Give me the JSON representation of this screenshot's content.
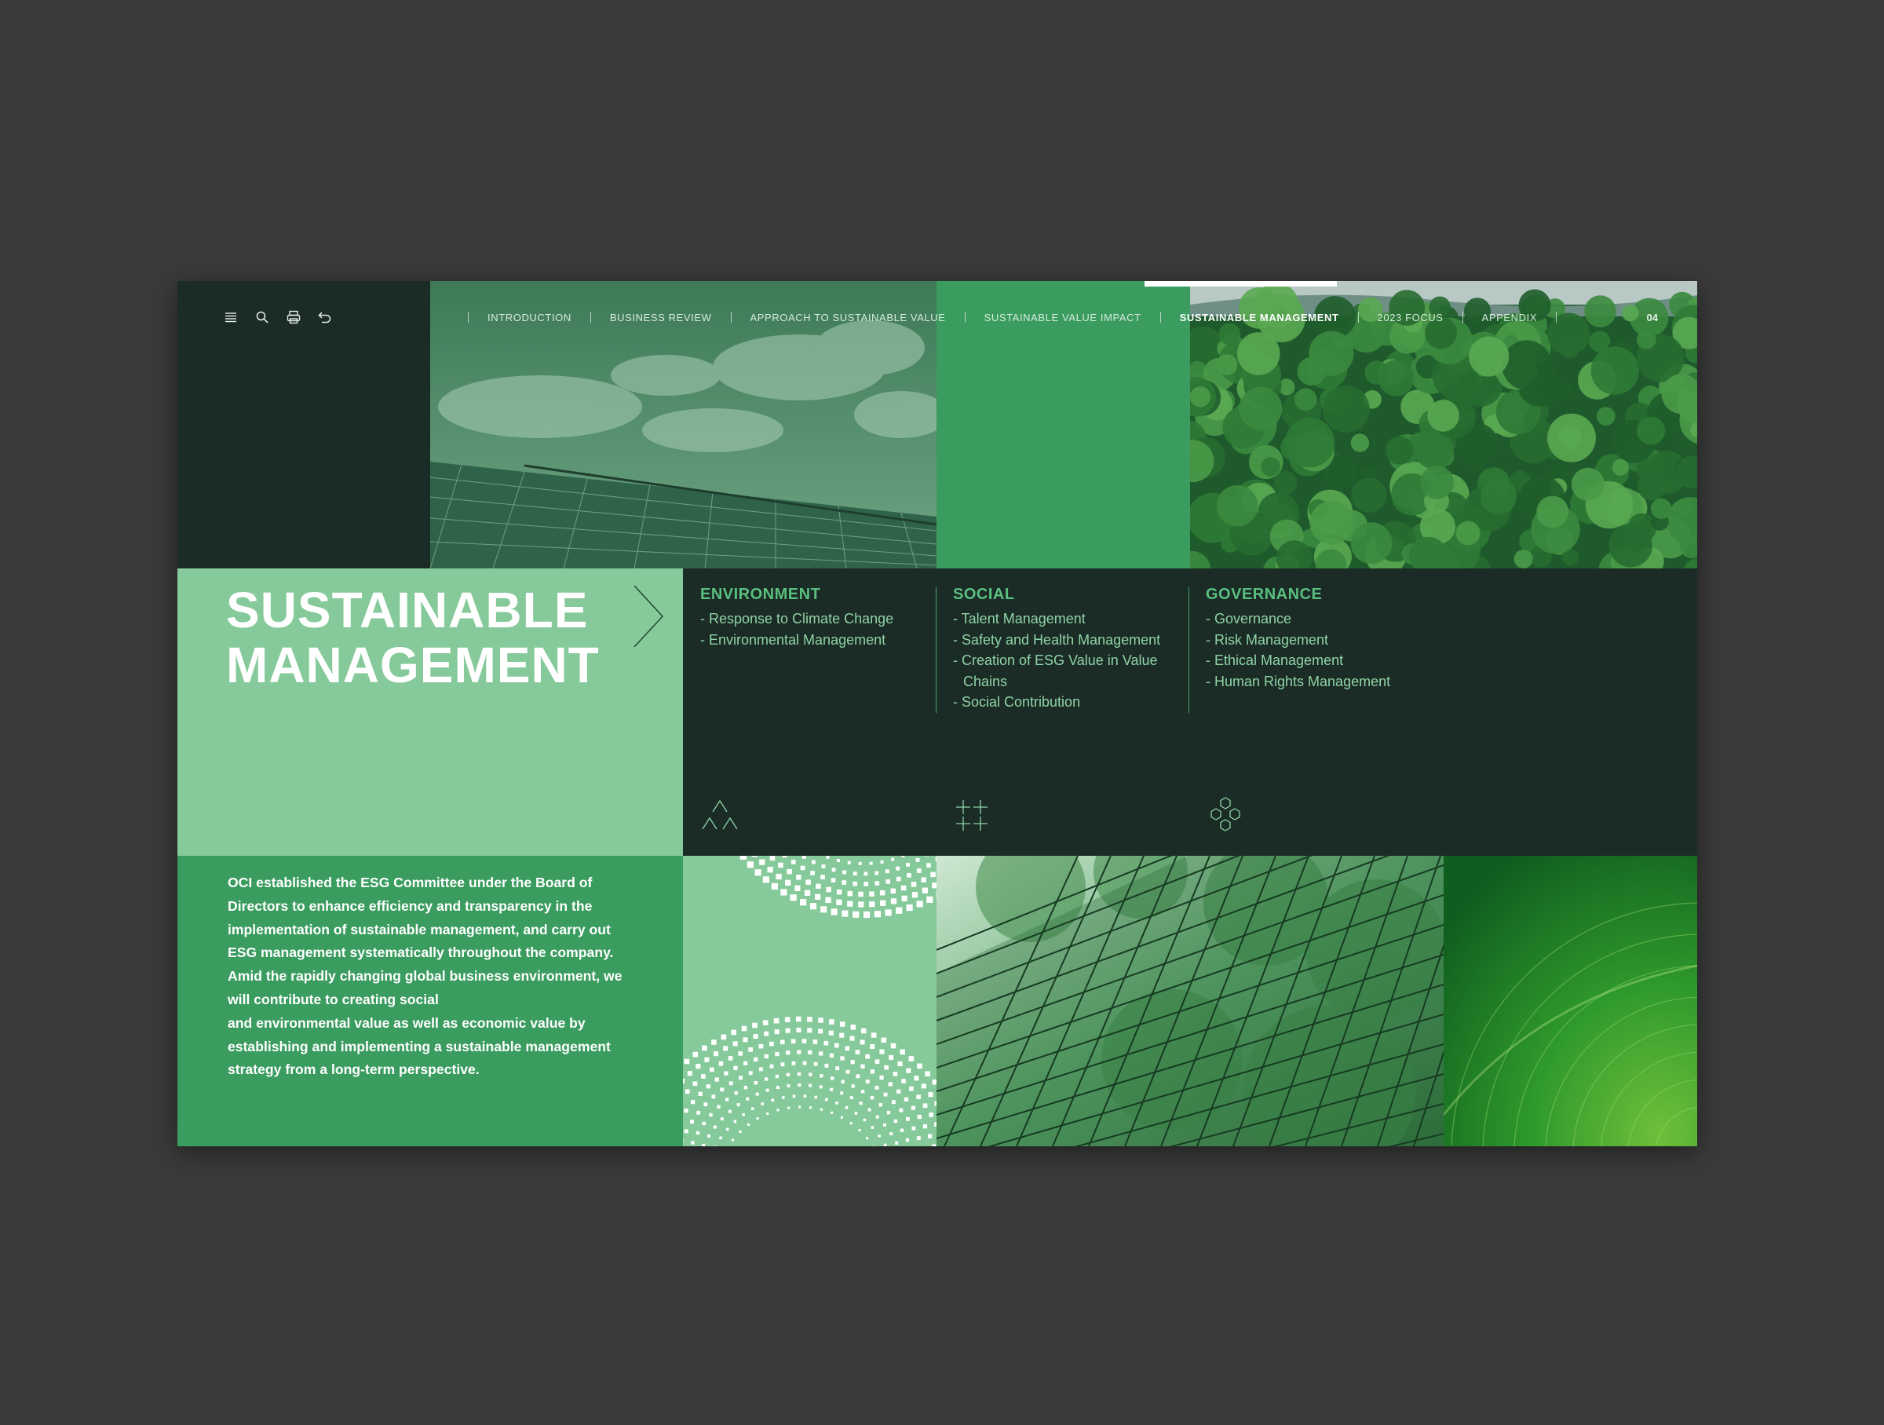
{
  "toolbar": {
    "icons": [
      "menu-icon",
      "search-icon",
      "print-icon",
      "back-icon"
    ]
  },
  "nav": {
    "items": [
      {
        "label": "INTRODUCTION"
      },
      {
        "label": "BUSINESS REVIEW"
      },
      {
        "label": "APPROACH TO SUSTAINABLE VALUE"
      },
      {
        "label": "SUSTAINABLE VALUE IMPACT"
      },
      {
        "label": "SUSTAINABLE MANAGEMENT"
      },
      {
        "label": "2023 FOCUS"
      },
      {
        "label": "APPENDIX"
      }
    ],
    "active": "SUSTAINABLE MANAGEMENT",
    "page_number": "04"
  },
  "hero": {
    "title_line1": "SUSTAINABLE",
    "title_line2": "MANAGEMENT"
  },
  "categories": {
    "environment": {
      "title": "ENVIRONMENT",
      "items": [
        "- Response to Climate Change",
        "- Environmental Management"
      ],
      "icon": "triangles-icon"
    },
    "social": {
      "title": "SOCIAL",
      "items": [
        "- Talent Management",
        "- Safety and Health Management",
        "- Creation of ESG Value in Value Chains",
        "- Social Contribution"
      ],
      "icon": "plus-grid-icon"
    },
    "governance": {
      "title": "GOVERNANCE",
      "items": [
        "- Governance",
        "- Risk Management",
        "- Ethical Management",
        "- Human Rights Management"
      ],
      "icon": "hexagons-icon"
    }
  },
  "description": {
    "lines": [
      "OCI established the ESG Committee under the Board of",
      "Directors to enhance efficiency and transparency in the",
      "implementation of sustainable management, and carry out",
      "ESG management  systematically throughout the company.",
      "Amid the rapidly changing global business environment, we",
      "will contribute to creating social",
      "and environmental value as well as economic value by",
      "establishing and implementing a sustainable management",
      "strategy from a long-term perspective."
    ]
  },
  "images": {
    "solar": "solar-panels-sky-image",
    "forest": "forest-aerial-image",
    "dots": "dotted-arcs-pattern",
    "glass": "glass-building-trees-image",
    "leaf": "green-leaf-closeup-image"
  },
  "colors": {
    "dark_green": "#1b2b26",
    "mid_green": "#3a9c5f",
    "light_green": "#86ca9b",
    "accent_text": "#59c07f",
    "background": "#3a3a3a"
  }
}
